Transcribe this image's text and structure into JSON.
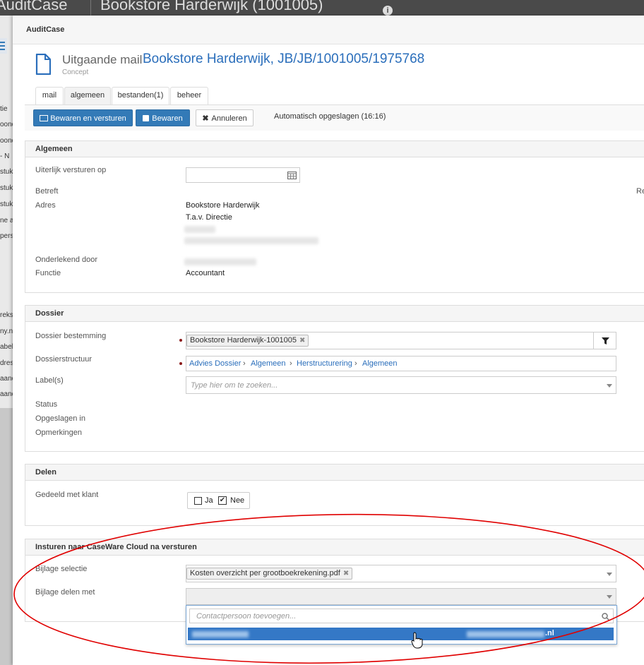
{
  "background": {
    "app_name": "AuditCase",
    "window_title": "Bookstore Harderwijk (1001005)",
    "info_icon": "info-icon",
    "left_items": [
      "tie",
      "oond",
      "oond",
      "- N",
      "stuk",
      "stuk",
      "stuk",
      "ne a",
      "pers",
      "reks",
      "ny.n",
      "abel",
      "dres",
      "aand",
      "aand"
    ]
  },
  "modal": {
    "header_title": "AuditCase",
    "doc_icon": "document-icon",
    "title_prefix": "Uitgaande mail",
    "title_link": "Bookstore Harderwijk, JB/JB/1001005/1975768",
    "subtitle": "Concept",
    "tabs": [
      {
        "label": "mail"
      },
      {
        "label": "algemeen",
        "active": true
      },
      {
        "label": "bestanden(1)"
      },
      {
        "label": "beheer"
      }
    ],
    "toolbar": {
      "save_send_label": "Bewaren en versturen",
      "save_label": "Bewaren",
      "cancel_label": "Annuleren",
      "autosave_text": "Automatisch opgeslagen (16:16)"
    }
  },
  "algemeen": {
    "title": "Algemeen",
    "send_before_label": "Uiterlijk versturen op",
    "send_before_value": "",
    "betreft_label": "Betreft",
    "right_cut": "Re",
    "adres_label": "Adres",
    "adres_line1": "Bookstore Harderwijk",
    "adres_line2": "T.a.v. Directie",
    "ondertekend_label": "Onderlekend door",
    "functie_label": "Functie",
    "functie_value": "Accountant"
  },
  "dossier": {
    "title": "Dossier",
    "bestemming_label": "Dossier bestemming",
    "bestemming_tag": "Bookstore Harderwijk-1001005",
    "structuur_label": "Dossierstructuur",
    "crumbs": [
      "Advies Dossier",
      "Algemeen",
      "Herstructurering",
      "Algemeen"
    ],
    "labels_label": "Label(s)",
    "labels_placeholder": "Type hier om te zoeken...",
    "status_label": "Status",
    "opgeslagen_label": "Opgeslagen in",
    "opmerkingen_label": "Opmerkingen"
  },
  "delen": {
    "title": "Delen",
    "gedeeld_label": "Gedeeld met klant",
    "ja_label": "Ja",
    "nee_label": "Nee",
    "ja_checked": false,
    "nee_checked": true
  },
  "casewire": {
    "title": "Insturen naar CaseWare Cloud na versturen",
    "bijlage_selectie_label": "Bijlage selectie",
    "bijlage_tag": "Kosten overzicht per grootboekrekening.pdf",
    "bijlage_delen_label": "Bijlage delen met",
    "search_placeholder": "Contactpersoon toevoegen...",
    "option_email_suffix": ".nl"
  },
  "colors": {
    "primary": "#337ab7",
    "link": "#2a6ebb",
    "annotation": "#e00000",
    "highlight": "#3478c6"
  }
}
